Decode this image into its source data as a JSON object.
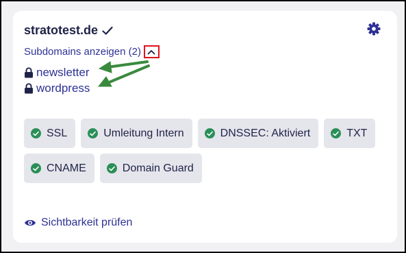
{
  "domain": {
    "name": "stratotest.de",
    "verified_icon": "check-icon",
    "settings_icon": "gear-icon"
  },
  "subdomains": {
    "toggle_label": "Subdomains anzeigen (2)",
    "toggle_icon": "chevron-up-icon",
    "items": [
      {
        "label": "newsletter",
        "icon": "lock-icon"
      },
      {
        "label": "wordpress",
        "icon": "lock-icon"
      }
    ]
  },
  "badges": [
    {
      "label": "SSL",
      "status": "active"
    },
    {
      "label": "Umleitung Intern",
      "status": "active"
    },
    {
      "label": "DNSSEC: Aktiviert",
      "status": "active"
    },
    {
      "label": "TXT",
      "status": "active"
    },
    {
      "label": "CNAME",
      "status": "active"
    },
    {
      "label": "Domain Guard",
      "status": "active"
    }
  ],
  "visibility": {
    "label": "Sichtbarkeit prüfen",
    "icon": "eye-icon"
  },
  "colors": {
    "link": "#2e3195",
    "text": "#1f2347",
    "status_ok": "#2a8f57",
    "highlight_box": "#e0131b",
    "annotation_arrow": "#3a8a3e",
    "badge_bg": "#e5e5ec",
    "page_bg": "#f1f1f4"
  }
}
